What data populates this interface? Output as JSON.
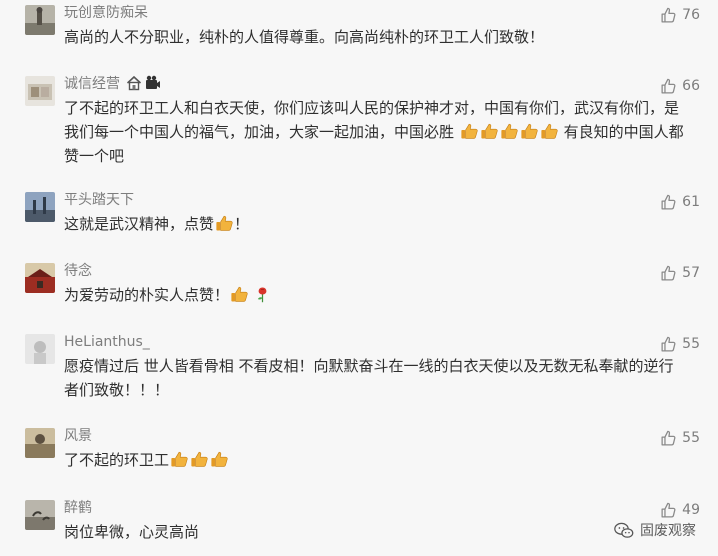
{
  "comments": [
    {
      "username": "玩创意防痴呆",
      "likes": "76",
      "text": "高尚的人不分职业，纯朴的人值得尊重。向高尚纯朴的环卫工人们致敬！",
      "avatar_color": "#8b8b7a"
    },
    {
      "username": "诚信经营",
      "likes": "66",
      "text": "了不起的环卫工人和白衣天使，你们应该叫人民的保护神才对，中国有你们，武汉有你们，是我们每一个中国人的福气，加油，大家一起加油，中国必胜",
      "text_after": "有良知的中国人都赞一个吧",
      "emoji_count": 5,
      "avatar_color": "#c9c2b4"
    },
    {
      "username": "平头踏天下",
      "likes": "61",
      "text": "这就是武汉精神，点赞",
      "text_after": "！",
      "emoji_count": 1,
      "avatar_color": "#6f86a6"
    },
    {
      "username": "待念",
      "likes": "57",
      "text": "为爱劳动的朴实人点赞！",
      "emoji_count": 1,
      "has_rose": true,
      "avatar_color": "#a03a2a"
    },
    {
      "username": "HeLianthus_",
      "likes": "55",
      "text": "愿疫情过后 世人皆看骨相 不看皮相！向默默奋斗在一线的白衣天使以及无数无私奉献的逆行者们致敬！！！",
      "avatar_color": "#dcdcdc"
    },
    {
      "username": "风景",
      "likes": "55",
      "text": "了不起的环卫工",
      "emoji_count": 3,
      "avatar_color": "#b5a58a"
    },
    {
      "username": "醉鹤",
      "likes": "49",
      "text": "岗位卑微，心灵高尚",
      "avatar_color": "#9a958a"
    }
  ],
  "watermark": {
    "text": "固废观察"
  },
  "colors": {
    "text": "#2f2f2f",
    "meta": "#7d7d7d",
    "background": "#f7f7f7",
    "emoji_yellow": "#f2b33d"
  }
}
